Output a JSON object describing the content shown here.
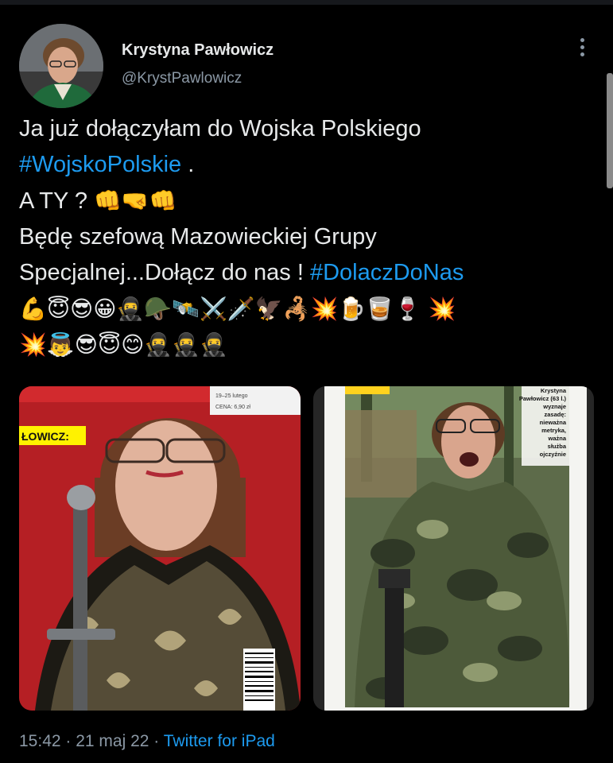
{
  "author": {
    "name": "Krystyna Pawłowicz",
    "handle": "@KrystPawlowicz"
  },
  "tweet": {
    "line1": "Ja już dołączyłam do Wojska Polskiego",
    "hashtag1": "#WojskoPolskie",
    "line2_suffix": " .",
    "line3_text": "A TY ?",
    "line3_emoji": "👊🤜👊",
    "line4": "Będę  szefową Mazowieckiej Grupy",
    "line5_text": "Specjalnej...Dołącz do nas ! ",
    "hashtag2": "#DolaczDoNas",
    "emoji_row1": "💪😇😎😀🥷🪖🛰️⚔️🗡️🦅🦂💥🍺🥃🍷 💥",
    "emoji_row2": "💥👼😎😇😊🥷🥷🥷"
  },
  "images": {
    "left_caption": "ŁOWICZ:",
    "left_cover_date": "19–25 lutego",
    "left_price": "CENA: 6,90 zł",
    "right_caption_lines": [
      "Krystyna",
      "Pawłowicz (63 l.)",
      "wyznaje",
      "zasadę:",
      "nieważna",
      "metryka,",
      "ważna",
      "służba",
      "ojczyźnie"
    ]
  },
  "meta": {
    "time": "15:42",
    "date": "21 maj 22",
    "separator": " · ",
    "source": "Twitter for iPad"
  },
  "colors": {
    "background": "#000000",
    "text": "#e7e9ea",
    "secondary": "#8b98a5",
    "link": "#1d9bf0"
  }
}
